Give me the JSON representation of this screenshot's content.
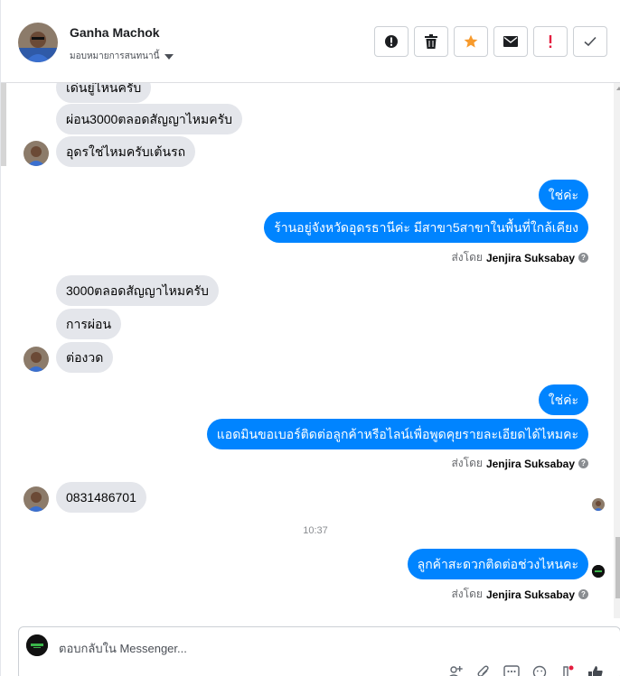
{
  "header": {
    "contact_name": "Ganha Machok",
    "assign_label": "มอบหมายการสนทนานี้",
    "actions": [
      {
        "name": "report-button",
        "icon": "exclamation-circle-icon"
      },
      {
        "name": "delete-button",
        "icon": "trash-icon"
      },
      {
        "name": "star-button",
        "icon": "star-icon",
        "color": "#f79a2c"
      },
      {
        "name": "mark-unread-button",
        "icon": "envelope-icon"
      },
      {
        "name": "follow-up-button",
        "icon": "exclamation-icon",
        "color": "#e41e3f"
      },
      {
        "name": "mark-done-button",
        "icon": "check-icon"
      }
    ]
  },
  "messages": {
    "m1": "เด่นยู่ไหนครับ",
    "m2": "ผ่อน3000ตลอดสัญญาไหมครับ",
    "m3": "อุดรใช่ไหมครับเต้นรถ",
    "m4": "ใช่ค่ะ",
    "m5": "ร้านอยู่จังหวัดอุดรธานีค่ะ มีสาขา5สาขาในพื้นที่ใกล้เคียง",
    "m6": "3000ตลอดสัญญาไหมครับ",
    "m7": "การผ่อน",
    "m8": "ต่องวด",
    "m9": "ใช่ค่ะ",
    "m10": "แอดมินขอเบอร์ติดต่อลูกค้าหรือไลน์เพื่อพูดคุยรายละเอียดได้ไหมคะ",
    "m11": "0831486701",
    "m12": "ลูกค้าสะดวกติดต่อช่วงไหนคะ"
  },
  "sent_by": {
    "prefix": "ส่งโดย",
    "agent": "Jenjira Suksabay",
    "help": "?"
  },
  "timestamp": "10:37",
  "composer": {
    "placeholder": "ตอบกลับใน Messenger...",
    "tools": [
      "add-person-icon",
      "paperclip-icon",
      "saved-reply-icon",
      "emoji-icon",
      "tag-icon",
      "thumbs-up-icon"
    ]
  },
  "colors": {
    "outgoing": "#0084ff",
    "incoming": "#e4e6eb",
    "star": "#f79a2c",
    "alert": "#e41e3f"
  }
}
